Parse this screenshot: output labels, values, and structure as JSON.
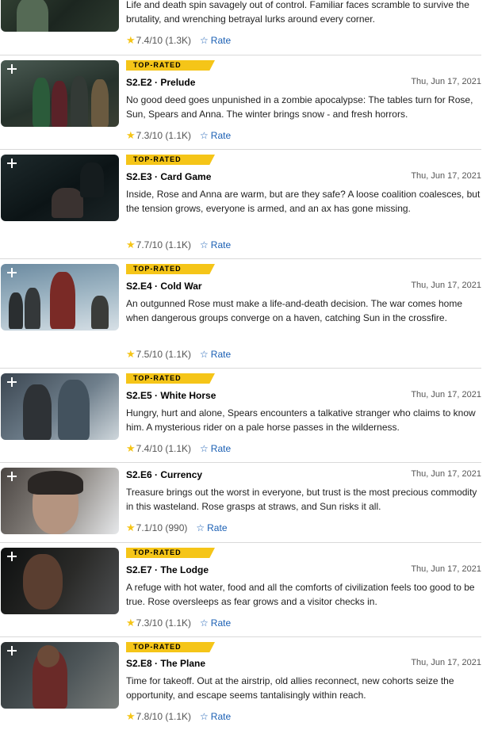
{
  "top_partial": {
    "plot": "Life and death spin savagely out of control. Familiar faces scramble to survive the brutality, and wrenching betrayal lurks around every corner.",
    "rating": "7.4/10 (1.3K)",
    "rate_label": "Rate"
  },
  "episodes": [
    {
      "badge": "TOP-RATED",
      "title": "S2.E2 · Prelude",
      "date": "Thu, Jun 17, 2021",
      "plot": "No good deed goes unpunished in a zombie apocalypse: The tables turn for Rose, Sun, Spears and Anna. The winter brings snow - and fresh horrors.",
      "rating": "7.3/10 (1.1K)",
      "rate_label": "Rate"
    },
    {
      "badge": "TOP-RATED",
      "title": "S2.E3 · Card Game",
      "date": "Thu, Jun 17, 2021",
      "plot": "Inside, Rose and Anna are warm, but are they safe? A loose coalition coalesces, but the tension grows, everyone is armed, and an ax has gone missing.",
      "rating": "7.7/10 (1.1K)",
      "rate_label": "Rate"
    },
    {
      "badge": "TOP-RATED",
      "title": "S2.E4 · Cold War",
      "date": "Thu, Jun 17, 2021",
      "plot": "An outgunned Rose must make a life-and-death decision. The war comes home when dangerous groups converge on a haven, catching Sun in the crossfire.",
      "rating": "7.5/10 (1.1K)",
      "rate_label": "Rate"
    },
    {
      "badge": "TOP-RATED",
      "title": "S2.E5 · White Horse",
      "date": "Thu, Jun 17, 2021",
      "plot": "Hungry, hurt and alone, Spears encounters a talkative stranger who claims to know him. A mysterious rider on a pale horse passes in the wilderness.",
      "rating": "7.4/10 (1.1K)",
      "rate_label": "Rate"
    },
    {
      "badge": "",
      "title": "S2.E6 · Currency",
      "date": "Thu, Jun 17, 2021",
      "plot": "Treasure brings out the worst in everyone, but trust is the most precious commodity in this wasteland. Rose grasps at straws, and Sun risks it all.",
      "rating": "7.1/10 (990)",
      "rate_label": "Rate"
    },
    {
      "badge": "TOP-RATED",
      "title": "S2.E7 · The Lodge",
      "date": "Thu, Jun 17, 2021",
      "plot": "A refuge with hot water, food and all the comforts of civilization feels too good to be true. Rose oversleeps as fear grows and a visitor checks in.",
      "rating": "7.3/10 (1.1K)",
      "rate_label": "Rate"
    },
    {
      "badge": "TOP-RATED",
      "title": "S2.E8 · The Plane",
      "date": "Thu, Jun 17, 2021",
      "plot": "Time for takeoff. Out at the airstrip, old allies reconnect, new cohorts seize the opportunity, and escape seems tantalisingly within reach.",
      "rating": "7.8/10 (1.1K)",
      "rate_label": "Rate"
    }
  ],
  "icons": {
    "star": "star-icon",
    "rate": "star-outline-icon",
    "add": "plus-icon"
  },
  "colors": {
    "badge": "#f5c518",
    "link": "#1a5fb4",
    "star": "#f5c518"
  }
}
